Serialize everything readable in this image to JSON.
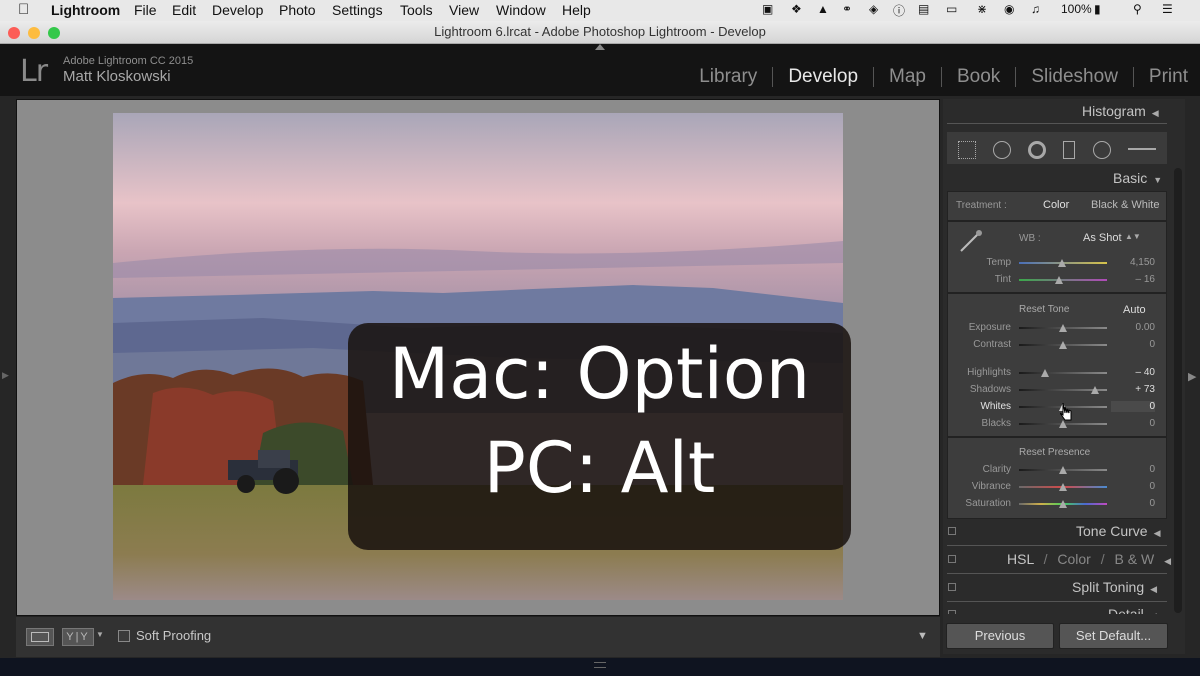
{
  "menubar": {
    "app": "Lightroom",
    "items": [
      "File",
      "Edit",
      "Develop",
      "Photo",
      "Settings",
      "Tools",
      "View",
      "Window",
      "Help"
    ],
    "battery": "100%"
  },
  "window": {
    "title": "Lightroom 6.lrcat - Adobe Photoshop Lightroom - Develop"
  },
  "identity": {
    "logo": "Lr",
    "product": "Adobe Lightroom CC 2015",
    "user": "Matt Kloskowski"
  },
  "modules": [
    "Library",
    "Develop",
    "Map",
    "Book",
    "Slideshow",
    "Print"
  ],
  "active_module": "Develop",
  "overlay": {
    "line1": "Mac: Option",
    "line2": "PC: Alt"
  },
  "toolbar": {
    "yy_label": "Y|Y",
    "soft_proofing": "Soft Proofing"
  },
  "panels": {
    "histogram": "Histogram",
    "basic": "Basic",
    "treatment_label": "Treatment :",
    "treatment_color": "Color",
    "treatment_bw": "Black & White",
    "wb_label": "WB :",
    "wb_value": "As Shot",
    "reset_tone": "Reset Tone",
    "auto": "Auto",
    "reset_presence": "Reset Presence",
    "tone_curve": "Tone Curve",
    "hsl": "HSL",
    "hsl_color": "Color",
    "hsl_bw": "B & W",
    "hsl_sep": "/",
    "split_toning": "Split Toning",
    "detail": "Detail"
  },
  "sliders": {
    "temp": {
      "label": "Temp",
      "value": "4,150",
      "pos": 0.49
    },
    "tint": {
      "label": "Tint",
      "value": "– 16",
      "pos": 0.46
    },
    "exposure": {
      "label": "Exposure",
      "value": "0.00",
      "pos": 0.5
    },
    "contrast": {
      "label": "Contrast",
      "value": "0",
      "pos": 0.5
    },
    "highlights": {
      "label": "Highlights",
      "value": "– 40",
      "pos": 0.3
    },
    "shadows": {
      "label": "Shadows",
      "value": "+ 73",
      "pos": 0.865
    },
    "whites": {
      "label": "Whites",
      "value": "0",
      "pos": 0.5
    },
    "blacks": {
      "label": "Blacks",
      "value": "0",
      "pos": 0.5
    },
    "clarity": {
      "label": "Clarity",
      "value": "0",
      "pos": 0.5
    },
    "vibrance": {
      "label": "Vibrance",
      "value": "0",
      "pos": 0.5
    },
    "saturation": {
      "label": "Saturation",
      "value": "0",
      "pos": 0.5
    }
  },
  "buttons": {
    "previous": "Previous",
    "set_default": "Set Default..."
  },
  "colors": {
    "active_module": "#e8e8e8",
    "inactive_module": "#8e8e8e",
    "panel_bg": "#2b2b2b"
  }
}
